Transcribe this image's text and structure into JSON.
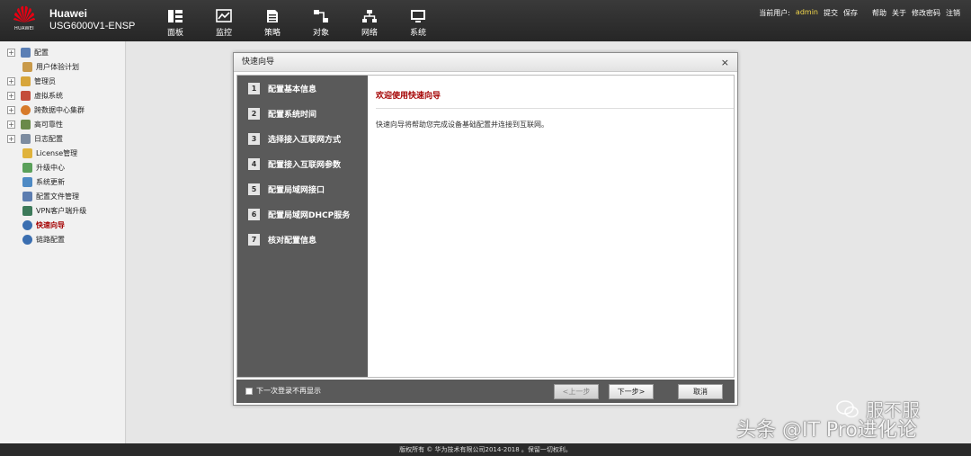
{
  "header": {
    "logo_text": "HUAWEI",
    "brand_line1": "Huawei",
    "brand_line2": "USG6000V1-ENSP",
    "nav": [
      {
        "label": "面板",
        "icon": "dashboard-icon"
      },
      {
        "label": "监控",
        "icon": "monitor-icon"
      },
      {
        "label": "策略",
        "icon": "policy-icon"
      },
      {
        "label": "对象",
        "icon": "object-icon"
      },
      {
        "label": "网络",
        "icon": "network-icon"
      },
      {
        "label": "系统",
        "icon": "system-icon"
      }
    ],
    "user_prefix": "当前用户:",
    "user_name": "admin",
    "links": {
      "submit": "提交",
      "save": "保存",
      "help": "帮助",
      "about": "关于",
      "change_password": "修改密码",
      "logout": "注销"
    },
    "user_name_color": "#f3d74b"
  },
  "sidebar": {
    "items": [
      {
        "label": "配置",
        "expandable": true
      },
      {
        "label": "用户体验计划",
        "expandable": false
      },
      {
        "label": "管理员",
        "expandable": true
      },
      {
        "label": "虚拟系统",
        "expandable": true
      },
      {
        "label": "跨数据中心集群",
        "expandable": true
      },
      {
        "label": "高可靠性",
        "expandable": true
      },
      {
        "label": "日志配置",
        "expandable": true
      },
      {
        "label": "License管理",
        "expandable": false
      },
      {
        "label": "升级中心",
        "expandable": false
      },
      {
        "label": "系统更新",
        "expandable": false
      },
      {
        "label": "配置文件管理",
        "expandable": false
      },
      {
        "label": "VPN客户端升级",
        "expandable": false
      },
      {
        "label": "快速向导",
        "expandable": false,
        "active": true
      },
      {
        "label": "链路配置",
        "expandable": false
      }
    ],
    "expand_symbol": "+"
  },
  "dialog": {
    "title": "快速向导",
    "close_symbol": "×",
    "steps": [
      {
        "num": "1",
        "label": "配置基本信息"
      },
      {
        "num": "2",
        "label": "配置系统时间"
      },
      {
        "num": "3",
        "label": "选择接入互联网方式"
      },
      {
        "num": "4",
        "label": "配置接入互联网参数"
      },
      {
        "num": "5",
        "label": "配置局域网接口"
      },
      {
        "num": "6",
        "label": "配置局域网DHCP服务"
      },
      {
        "num": "7",
        "label": "核对配置信息"
      }
    ],
    "welcome_title": "欢迎使用快速向导",
    "welcome_text": "快速向导将帮助您完成设备基础配置并连接到互联网。",
    "checkbox_label": "下一次登录不再显示",
    "checkbox_checked": false,
    "buttons": {
      "prev": "<上一步",
      "next": "下一步>",
      "cancel": "取消"
    },
    "accent_color": "#a40000"
  },
  "footer": {
    "copyright": "版权所有 © 华为技术有限公司2014-2018 。保留一切权利。"
  },
  "watermark": {
    "top": "服不服",
    "bottom": "头条 @IT Pro进化论"
  }
}
